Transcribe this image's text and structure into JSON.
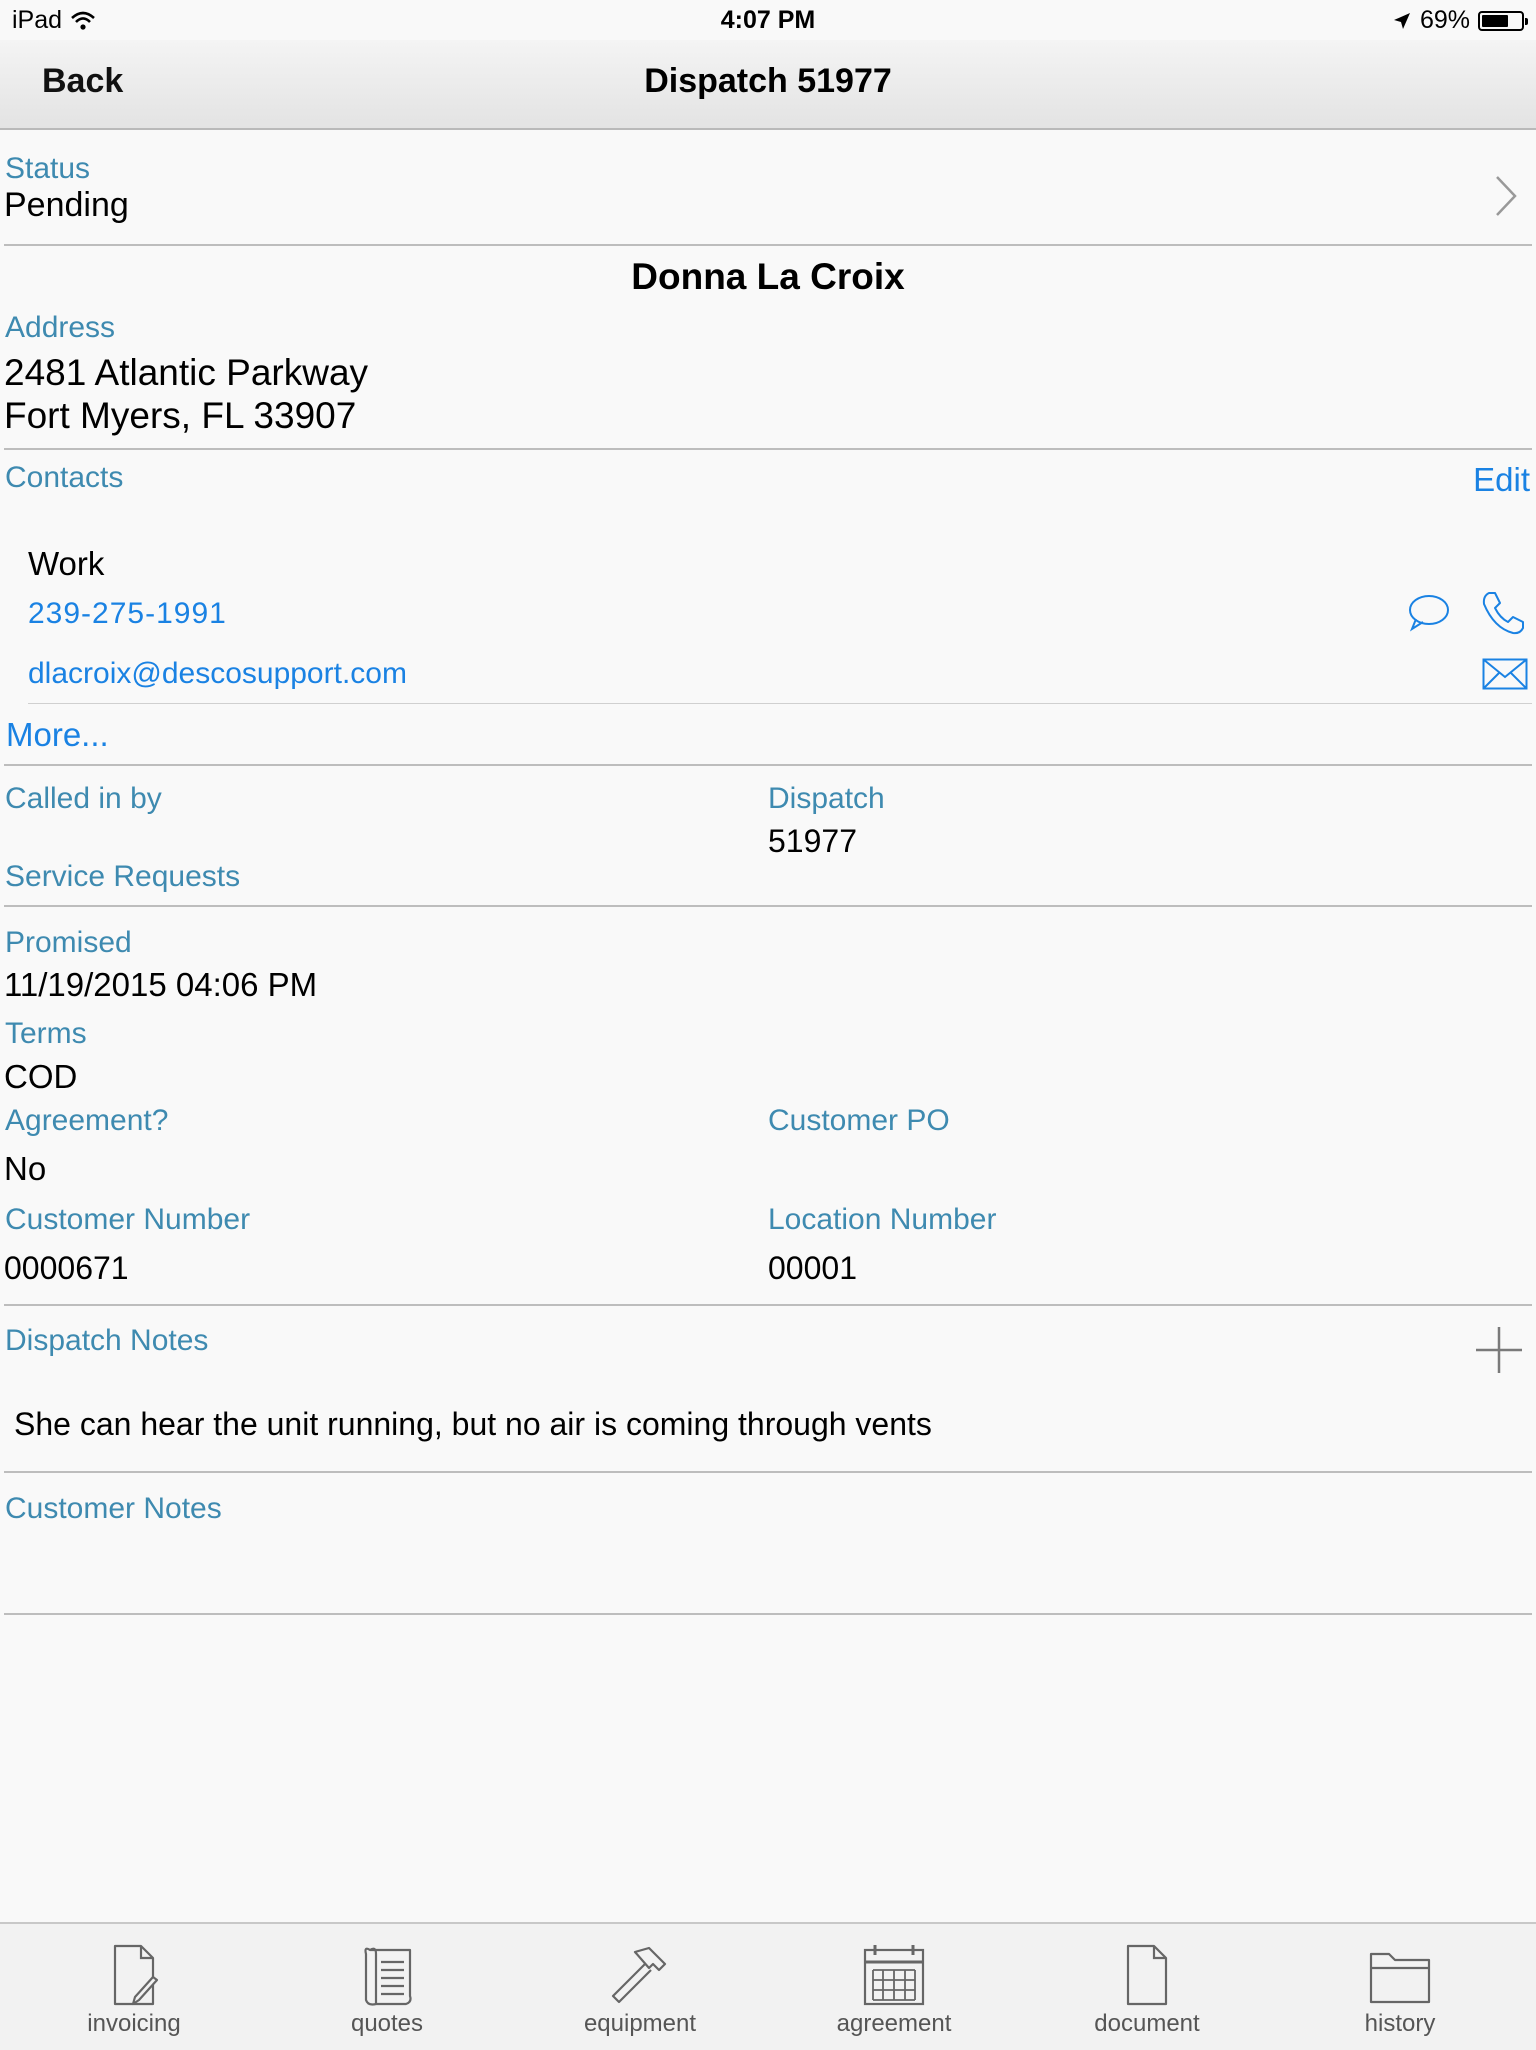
{
  "status_bar": {
    "device": "iPad",
    "time": "4:07 PM",
    "battery": "69%",
    "battery_level": 0.69
  },
  "nav": {
    "back_label": "Back",
    "title": "Dispatch 51977"
  },
  "status": {
    "label": "Status",
    "value": "Pending"
  },
  "customer_name": "Donna La Croix",
  "address": {
    "label": "Address",
    "line1": "2481 Atlantic Parkway",
    "line2": "Fort Myers, FL 33907"
  },
  "contacts": {
    "label": "Contacts",
    "edit_label": "Edit",
    "type": "Work",
    "phone": "239-275-1991",
    "email": "dlacroix@descosupport.com",
    "more_label": "More..."
  },
  "called_in_by": {
    "label": "Called in by"
  },
  "dispatch": {
    "label": "Dispatch",
    "value": "51977"
  },
  "service_requests": {
    "label": "Service Requests"
  },
  "promised": {
    "label": "Promised",
    "value": "11/19/2015 04:06 PM"
  },
  "terms": {
    "label": "Terms",
    "value": "COD"
  },
  "agreement": {
    "label": "Agreement?",
    "value": "No"
  },
  "customer_po": {
    "label": "Customer PO"
  },
  "customer_number": {
    "label": "Customer Number",
    "value": "0000671"
  },
  "location_number": {
    "label": "Location Number",
    "value": "00001"
  },
  "dispatch_notes": {
    "label": "Dispatch Notes",
    "text": "She can hear the unit running, but no air is coming through vents"
  },
  "customer_notes": {
    "label": "Customer Notes"
  },
  "tabs": [
    {
      "label": "invoicing",
      "icon": "invoicing-icon"
    },
    {
      "label": "quotes",
      "icon": "quotes-icon"
    },
    {
      "label": "equipment",
      "icon": "hammer-icon"
    },
    {
      "label": "agreement",
      "icon": "calendar-icon"
    },
    {
      "label": "document",
      "icon": "document-icon"
    },
    {
      "label": "history",
      "icon": "folder-icon"
    }
  ],
  "colors": {
    "label": "#3e8ab0",
    "link": "#1a82e3",
    "divider": "#bdbdbd"
  }
}
